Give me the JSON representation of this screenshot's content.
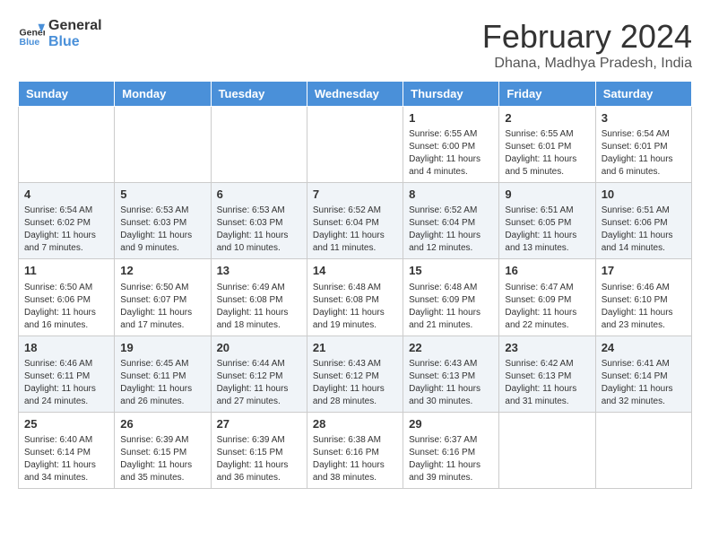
{
  "header": {
    "logo_general": "General",
    "logo_blue": "Blue",
    "month_title": "February 2024",
    "location": "Dhana, Madhya Pradesh, India"
  },
  "days_of_week": [
    "Sunday",
    "Monday",
    "Tuesday",
    "Wednesday",
    "Thursday",
    "Friday",
    "Saturday"
  ],
  "weeks": [
    [
      {
        "day": "",
        "info": ""
      },
      {
        "day": "",
        "info": ""
      },
      {
        "day": "",
        "info": ""
      },
      {
        "day": "",
        "info": ""
      },
      {
        "day": "1",
        "info": "Sunrise: 6:55 AM\nSunset: 6:00 PM\nDaylight: 11 hours and 4 minutes."
      },
      {
        "day": "2",
        "info": "Sunrise: 6:55 AM\nSunset: 6:01 PM\nDaylight: 11 hours and 5 minutes."
      },
      {
        "day": "3",
        "info": "Sunrise: 6:54 AM\nSunset: 6:01 PM\nDaylight: 11 hours and 6 minutes."
      }
    ],
    [
      {
        "day": "4",
        "info": "Sunrise: 6:54 AM\nSunset: 6:02 PM\nDaylight: 11 hours and 7 minutes."
      },
      {
        "day": "5",
        "info": "Sunrise: 6:53 AM\nSunset: 6:03 PM\nDaylight: 11 hours and 9 minutes."
      },
      {
        "day": "6",
        "info": "Sunrise: 6:53 AM\nSunset: 6:03 PM\nDaylight: 11 hours and 10 minutes."
      },
      {
        "day": "7",
        "info": "Sunrise: 6:52 AM\nSunset: 6:04 PM\nDaylight: 11 hours and 11 minutes."
      },
      {
        "day": "8",
        "info": "Sunrise: 6:52 AM\nSunset: 6:04 PM\nDaylight: 11 hours and 12 minutes."
      },
      {
        "day": "9",
        "info": "Sunrise: 6:51 AM\nSunset: 6:05 PM\nDaylight: 11 hours and 13 minutes."
      },
      {
        "day": "10",
        "info": "Sunrise: 6:51 AM\nSunset: 6:06 PM\nDaylight: 11 hours and 14 minutes."
      }
    ],
    [
      {
        "day": "11",
        "info": "Sunrise: 6:50 AM\nSunset: 6:06 PM\nDaylight: 11 hours and 16 minutes."
      },
      {
        "day": "12",
        "info": "Sunrise: 6:50 AM\nSunset: 6:07 PM\nDaylight: 11 hours and 17 minutes."
      },
      {
        "day": "13",
        "info": "Sunrise: 6:49 AM\nSunset: 6:08 PM\nDaylight: 11 hours and 18 minutes."
      },
      {
        "day": "14",
        "info": "Sunrise: 6:48 AM\nSunset: 6:08 PM\nDaylight: 11 hours and 19 minutes."
      },
      {
        "day": "15",
        "info": "Sunrise: 6:48 AM\nSunset: 6:09 PM\nDaylight: 11 hours and 21 minutes."
      },
      {
        "day": "16",
        "info": "Sunrise: 6:47 AM\nSunset: 6:09 PM\nDaylight: 11 hours and 22 minutes."
      },
      {
        "day": "17",
        "info": "Sunrise: 6:46 AM\nSunset: 6:10 PM\nDaylight: 11 hours and 23 minutes."
      }
    ],
    [
      {
        "day": "18",
        "info": "Sunrise: 6:46 AM\nSunset: 6:11 PM\nDaylight: 11 hours and 24 minutes."
      },
      {
        "day": "19",
        "info": "Sunrise: 6:45 AM\nSunset: 6:11 PM\nDaylight: 11 hours and 26 minutes."
      },
      {
        "day": "20",
        "info": "Sunrise: 6:44 AM\nSunset: 6:12 PM\nDaylight: 11 hours and 27 minutes."
      },
      {
        "day": "21",
        "info": "Sunrise: 6:43 AM\nSunset: 6:12 PM\nDaylight: 11 hours and 28 minutes."
      },
      {
        "day": "22",
        "info": "Sunrise: 6:43 AM\nSunset: 6:13 PM\nDaylight: 11 hours and 30 minutes."
      },
      {
        "day": "23",
        "info": "Sunrise: 6:42 AM\nSunset: 6:13 PM\nDaylight: 11 hours and 31 minutes."
      },
      {
        "day": "24",
        "info": "Sunrise: 6:41 AM\nSunset: 6:14 PM\nDaylight: 11 hours and 32 minutes."
      }
    ],
    [
      {
        "day": "25",
        "info": "Sunrise: 6:40 AM\nSunset: 6:14 PM\nDaylight: 11 hours and 34 minutes."
      },
      {
        "day": "26",
        "info": "Sunrise: 6:39 AM\nSunset: 6:15 PM\nDaylight: 11 hours and 35 minutes."
      },
      {
        "day": "27",
        "info": "Sunrise: 6:39 AM\nSunset: 6:15 PM\nDaylight: 11 hours and 36 minutes."
      },
      {
        "day": "28",
        "info": "Sunrise: 6:38 AM\nSunset: 6:16 PM\nDaylight: 11 hours and 38 minutes."
      },
      {
        "day": "29",
        "info": "Sunrise: 6:37 AM\nSunset: 6:16 PM\nDaylight: 11 hours and 39 minutes."
      },
      {
        "day": "",
        "info": ""
      },
      {
        "day": "",
        "info": ""
      }
    ]
  ]
}
